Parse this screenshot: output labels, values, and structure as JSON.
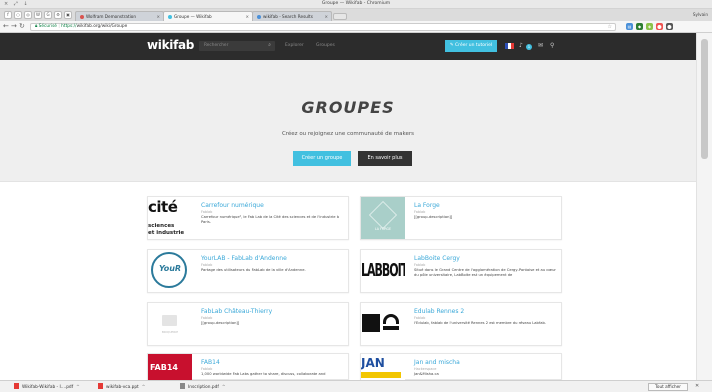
{
  "window": {
    "title": "Groupe — Wikifab - Chromium",
    "controls": "× ⤢ ↓"
  },
  "tabs": [
    {
      "label": "Wolfram Demonstration",
      "favicon_color": "#d9534f"
    },
    {
      "label": "Groupe — Wikifab",
      "favicon_color": "#42c0e0",
      "active": true
    },
    {
      "label": "wikifab - Search Results",
      "favicon_color": "#4a90d9"
    }
  ],
  "profile_label": "Sylvain",
  "extensions": [
    "f",
    "○",
    "◎",
    "W",
    "G",
    "⚙",
    "▣"
  ],
  "address_bar": {
    "secure": "Sécurisé",
    "protocol": "https://",
    "url": "wikifab.org/wiki/Groupe"
  },
  "toolbar_icons": [
    {
      "glyph": "▤",
      "color": "#4a90d9"
    },
    {
      "glyph": "◆",
      "color": "#2e7d32"
    },
    {
      "glyph": "◈",
      "color": "#8bc34a"
    },
    {
      "glyph": "⬤",
      "color": "#ef5350"
    },
    {
      "glyph": "⬤",
      "color": "#333333"
    }
  ],
  "site": {
    "logo": "wikifab",
    "search_placeholder": "Rechercher",
    "nav": [
      "Explorer",
      "Groupes"
    ],
    "create_tutorial": "✎ Créer un tutoriel",
    "notifications_count": "1"
  },
  "hero": {
    "title": "GROUPES",
    "subtitle": "Créez ou rejoignez une communauté de makers",
    "create_button": "Créer un groupe",
    "more_button": "En savoir plus"
  },
  "groups": [
    {
      "name": "Carrefour numérique",
      "kind": "Fablab",
      "desc": "Carrefour numérique², le Fab Lab de la Cité des sciences et de l'industrie à Paris.",
      "thumb": "cite"
    },
    {
      "name": "La Forge",
      "kind": "Fablab",
      "desc": "[[group-description]]",
      "thumb": "forge"
    },
    {
      "name": "YourLAB - FabLab d'Andenne",
      "kind": "Fablab",
      "desc": "Partage des utilisateurs du FabLab de la ville d'Andenne.",
      "thumb": "yourlab"
    },
    {
      "name": "LabBoite Cergy",
      "kind": "Fablab",
      "desc": "Situé dans le Grand Centre de l'agglomération de Cergy-Pontoise et au cœur du pôle universitaire, LabBoite est un équipement de",
      "thumb": "labboite"
    },
    {
      "name": "FabLab Château-Thierry",
      "kind": "Fablab",
      "desc": "[[group-description]]",
      "thumb": "placeholder"
    },
    {
      "name": "Edulab Rennes 2",
      "kind": "Fablab",
      "desc": "l'Edulab, fablab de l'université Rennes 2 est membre du réseau Labfab.",
      "thumb": "edulab"
    },
    {
      "name": "FAB14",
      "kind": "Fablab",
      "desc": "1,000 worldwide Fab Labs gather to share, discuss, collaborate and",
      "thumb": "fab14"
    },
    {
      "name": "Jan and mischa",
      "kind": "Hackerspace",
      "desc": "Jan&Misha.ca",
      "thumb": "jan"
    }
  ],
  "thumb_text": {
    "cite_big": "cité",
    "cite_small_1": "sciences",
    "cite_small_2": "et industrie",
    "forge": "LA FORGE",
    "yourlab": "YouR",
    "labboite": "LABBOITE",
    "placeholder": "BRIQUERIE",
    "fab14": "FAB14",
    "jan": "JAN"
  },
  "downloads": [
    {
      "name": "Wikifab-Wikifab - I....pdf"
    },
    {
      "name": "wikifab-vca.ppt"
    },
    {
      "name": "Inscription.pdf"
    }
  ],
  "downloads_show_all": "Tout afficher",
  "colors": {
    "accent": "#42c0e0",
    "nav_bg": "#2c2c2c",
    "link": "#3aa8d8",
    "hero_bg": "#efefef"
  }
}
